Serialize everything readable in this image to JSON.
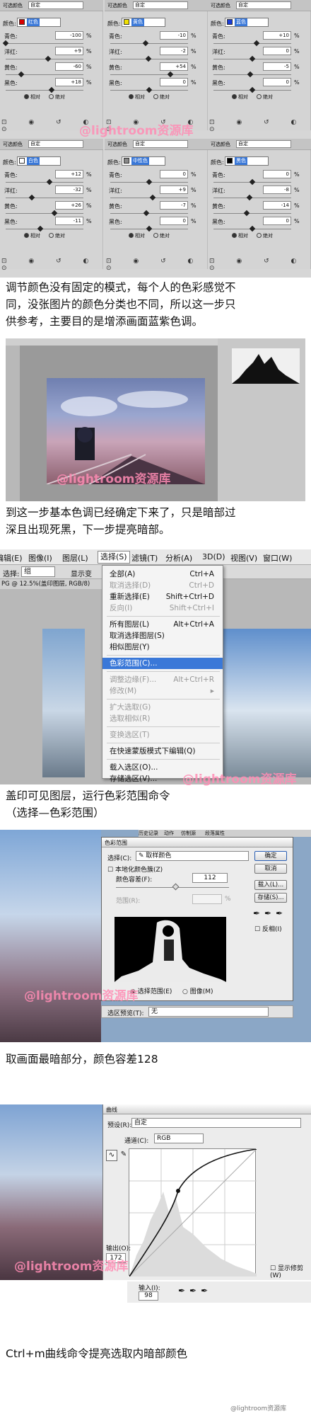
{
  "watermark": "@lightroom资源库",
  "selective_color": {
    "header_label": "可选颜色",
    "preset_label": "自定",
    "color_label": "颜色:",
    "mode_relative": "相对",
    "mode_absolute": "绝对",
    "tools": "⊡ ◉ ↺ ◐ ⊙",
    "rows_labels": [
      "青色:",
      "洋红:",
      "黄色:",
      "黑色:"
    ],
    "percent": "%",
    "panels": [
      {
        "color_name": "红色",
        "swatch": "#d80000",
        "values": [
          "-100",
          "+9",
          "-60",
          "+18"
        ],
        "levels": [
          0.0,
          0.545,
          0.2,
          0.59
        ]
      },
      {
        "color_name": "黄色",
        "swatch": "#f0e000",
        "values": [
          "-10",
          "-2",
          "+54",
          "0"
        ],
        "levels": [
          0.45,
          0.49,
          0.77,
          0.5
        ]
      },
      {
        "color_name": "蓝色",
        "swatch": "#1a3cd8",
        "values": [
          "+10",
          "0",
          "-5",
          "0"
        ],
        "levels": [
          0.55,
          0.5,
          0.475,
          0.5
        ]
      },
      {
        "color_name": "白色",
        "swatch": "#ffffff",
        "values": [
          "+12",
          "-32",
          "+26",
          "-11"
        ],
        "levels": [
          0.56,
          0.34,
          0.63,
          0.445
        ]
      },
      {
        "color_name": "中性色",
        "swatch": "#888888",
        "values": [
          "0",
          "+9",
          "-7",
          "0"
        ],
        "levels": [
          0.5,
          0.545,
          0.465,
          0.5
        ]
      },
      {
        "color_name": "黑色",
        "swatch": "#000000",
        "values": [
          "0",
          "-8",
          "-14",
          "0"
        ],
        "levels": [
          0.5,
          0.46,
          0.43,
          0.5
        ]
      }
    ]
  },
  "caption1": [
    "调节颜色没有固定的模式，每个人的色彩感觉不",
    "同，没张图片的颜色分类也不同，所以这一步只",
    "供参考，主要目的是增添画面蓝紫色调。"
  ],
  "caption2": [
    "到这一步基本色调已经确定下来了，只是暗部过",
    "深且出现死黑，下一步提亮暗部。"
  ],
  "menubar": {
    "items": [
      "编辑(E)",
      "图像(I)",
      "图层(L)",
      "选择(S)",
      "滤镜(T)",
      "分析(A)",
      "3D(D)",
      "视图(V)",
      "窗口(W)"
    ],
    "toolbar_group": "组",
    "toolbar_show": "显示变",
    "doc_tab": "PG @ 12.5%(盖印图层, RGB/8)"
  },
  "select_menu": [
    {
      "label": "全部(A)",
      "shortcut": "Ctrl+A",
      "disabled": false
    },
    {
      "label": "取消选择(D)",
      "shortcut": "Ctrl+D",
      "disabled": true
    },
    {
      "label": "重新选择(E)",
      "shortcut": "Shift+Ctrl+D",
      "disabled": false
    },
    {
      "label": "反向(I)",
      "shortcut": "Shift+Ctrl+I",
      "disabled": true
    },
    {
      "sep": true
    },
    {
      "label": "所有图层(L)",
      "shortcut": "Alt+Ctrl+A",
      "disabled": false
    },
    {
      "label": "取消选择图层(S)",
      "shortcut": "",
      "disabled": false
    },
    {
      "label": "相似图层(Y)",
      "shortcut": "",
      "disabled": false
    },
    {
      "sep": true
    },
    {
      "label": "色彩范围(C)...",
      "shortcut": "",
      "disabled": false,
      "highlight": true
    },
    {
      "sep": true
    },
    {
      "label": "调整边缘(F)...",
      "shortcut": "Alt+Ctrl+R",
      "disabled": true
    },
    {
      "label": "修改(M)",
      "shortcut": "▸",
      "disabled": true
    },
    {
      "sep": true
    },
    {
      "label": "扩大选取(G)",
      "shortcut": "",
      "disabled": true
    },
    {
      "label": "选取相似(R)",
      "shortcut": "",
      "disabled": true
    },
    {
      "sep": true
    },
    {
      "label": "变换选区(T)",
      "shortcut": "",
      "disabled": true
    },
    {
      "sep": true
    },
    {
      "label": "在快速蒙版模式下编辑(Q)",
      "shortcut": "",
      "disabled": false
    },
    {
      "sep": true
    },
    {
      "label": "载入选区(O)...",
      "shortcut": "",
      "disabled": false
    },
    {
      "label": "存储选区(V)...",
      "shortcut": "",
      "disabled": false
    }
  ],
  "caption3": [
    "盖印可见图层，运行色彩范围命令",
    "（选择—色彩范围）"
  ],
  "color_range": {
    "title": "色彩范围",
    "select_label": "选择(C):",
    "select_value": "取样颜色",
    "localized": "本地化颜色簇(Z)",
    "fuzziness_label": "颜色容差(F):",
    "fuzziness_value": "112",
    "range_label": "范围(R):",
    "range_pct": "%",
    "ok": "确定",
    "cancel": "取消",
    "load": "载入(L)...",
    "save": "存储(S)...",
    "invert": "反相(I)",
    "radio_selection": "选择范围(E)",
    "radio_image": "图像(M)",
    "preview_label": "选区预览(T):",
    "preview_value": "无",
    "panel_tabs": [
      "历史记录",
      "动作",
      "仿制源",
      "段落属性"
    ]
  },
  "caption4": [
    "取画面最暗部分，颜色容差128"
  ],
  "curves": {
    "title": "曲线",
    "preset_label": "预设(R):",
    "preset_value": "自定",
    "channel_label": "通道(C):",
    "channel_value": "RGB",
    "output_label": "输出(O):",
    "output_value": "172",
    "input_label": "输入(I):",
    "input_value": "98",
    "show_clip": "显示修剪(W)"
  },
  "caption5": [
    "Ctrl+m曲线命令提亮选取内暗部颜色"
  ],
  "corner_credit": "@lightroom资源库"
}
